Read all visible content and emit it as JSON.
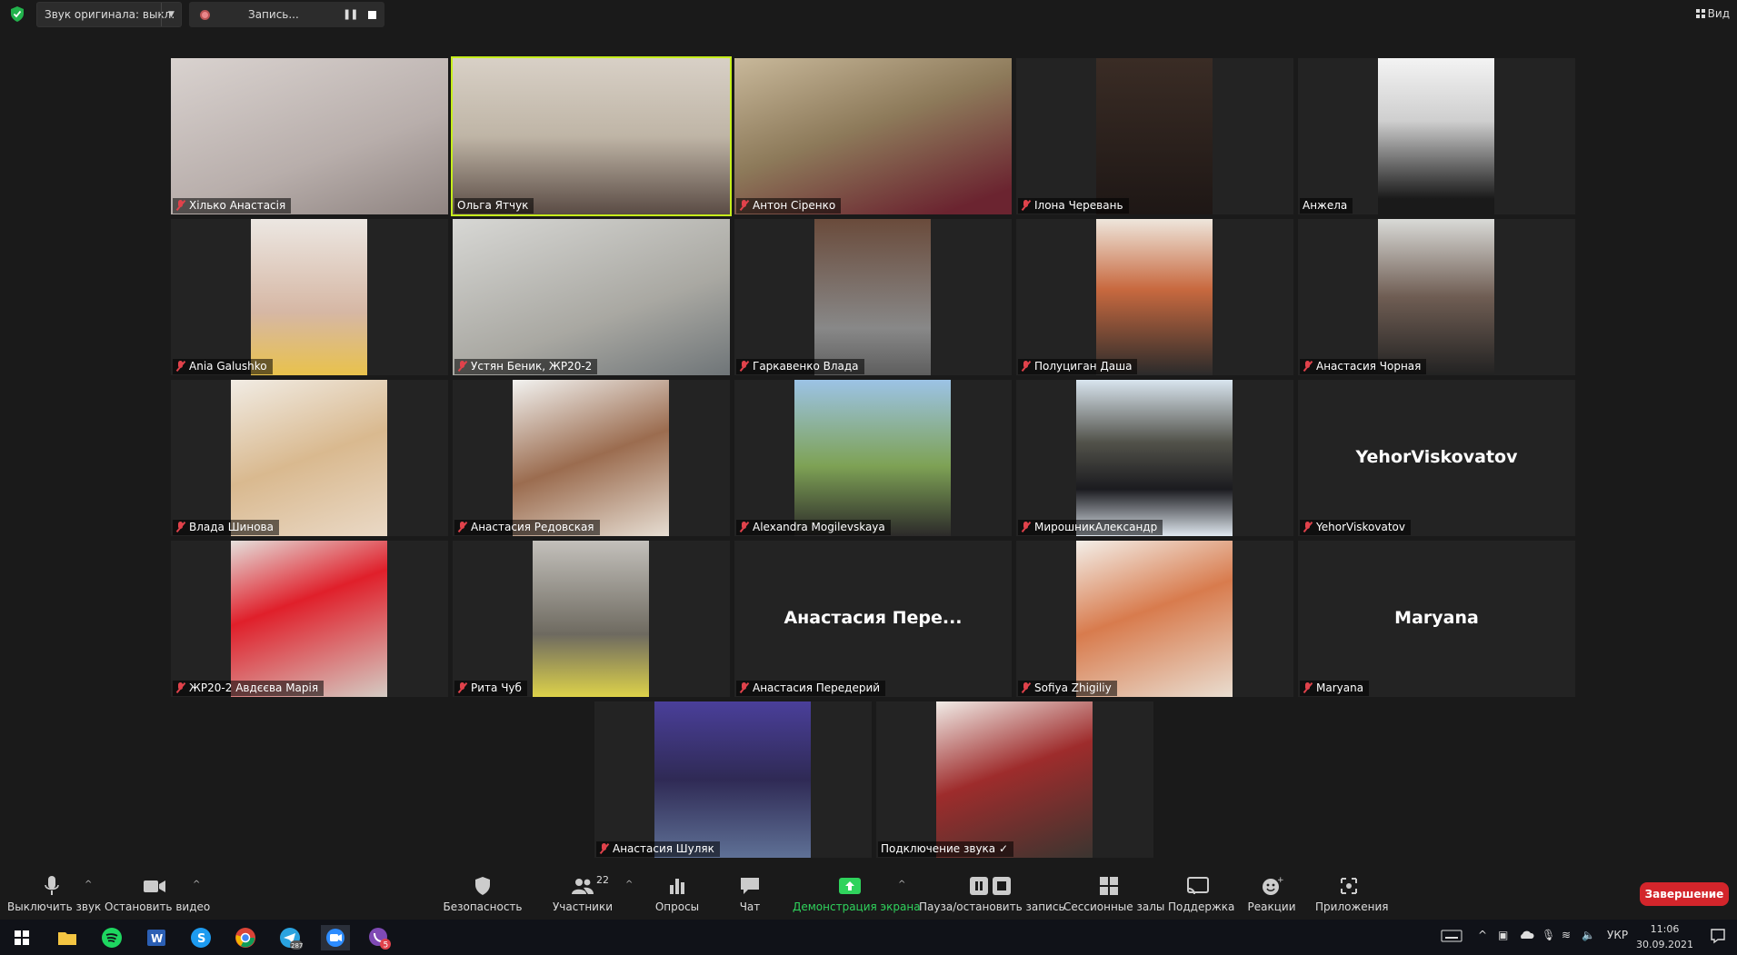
{
  "top_bar": {
    "audio_label": "Звук оригинала: выкл.",
    "record_label": "Запись...",
    "pause_symbol": "❚❚",
    "view_label": "Вид"
  },
  "participants": [
    {
      "name": "Хілько  Анастасія",
      "muted": true
    },
    {
      "name": "Ольга Ятчук",
      "muted": false,
      "active": true
    },
    {
      "name": "Антон Сіренко",
      "muted": true
    },
    {
      "name": "Ілона Черевань",
      "muted": true
    },
    {
      "name": "Анжела",
      "muted": false
    },
    {
      "name": "Ania Galushko",
      "muted": true
    },
    {
      "name": "Устян Беник, ЖР20-2",
      "muted": true
    },
    {
      "name": "Гаркавенко Влада",
      "muted": true
    },
    {
      "name": "Полуциган Даша",
      "muted": true
    },
    {
      "name": "Анастасия Чорная",
      "muted": true
    },
    {
      "name": "Влада Шинова",
      "muted": true
    },
    {
      "name": "Анастасия Редовская",
      "muted": true
    },
    {
      "name": "Alexandra Mogilevskaya",
      "muted": true
    },
    {
      "name": "МирошникАлександр",
      "muted": true
    },
    {
      "name": "YehorViskovatov",
      "muted": true,
      "video_off_name": "YehorViskovatov"
    },
    {
      "name": "ЖР20-2 Авдєєва Марія",
      "muted": true
    },
    {
      "name": "Рита Чуб",
      "muted": true
    },
    {
      "name": "Анастасия Передерий",
      "muted": true,
      "video_off_name": "Анастасия  Пере..."
    },
    {
      "name": "Sofiya Zhigiliy",
      "muted": true
    },
    {
      "name": "Maryana",
      "muted": true,
      "video_off_name": "Maryana"
    },
    {
      "name": "Анастасия Шуляк",
      "muted": true
    },
    {
      "name": "Подключение звука ✓",
      "muted": false
    }
  ],
  "toolbar": {
    "mute_label": "Выключить звук",
    "video_label": "Остановить видео",
    "security_label": "Безопасность",
    "participants_label": "Участники",
    "participants_count": "22",
    "polls_label": "Опросы",
    "chat_label": "Чат",
    "share_label": "Демонстрация экрана",
    "pause_record_label": "Пауза/остановить запись",
    "breakout_label": "Сессионные залы",
    "support_label": "Поддержка",
    "reactions_label": "Реакции",
    "apps_label": "Приложения",
    "end_label": "Завершение"
  },
  "colors": {
    "active_speaker": "#c6ee1c",
    "end_button": "#d3252b",
    "share_green": "#2fd35c",
    "mute_red": "#e0424b"
  },
  "taskbar": {
    "viber_badge": "5",
    "telegram_badge": "287",
    "language": "УКР",
    "time": "11:06",
    "date": "30.09.2021"
  }
}
